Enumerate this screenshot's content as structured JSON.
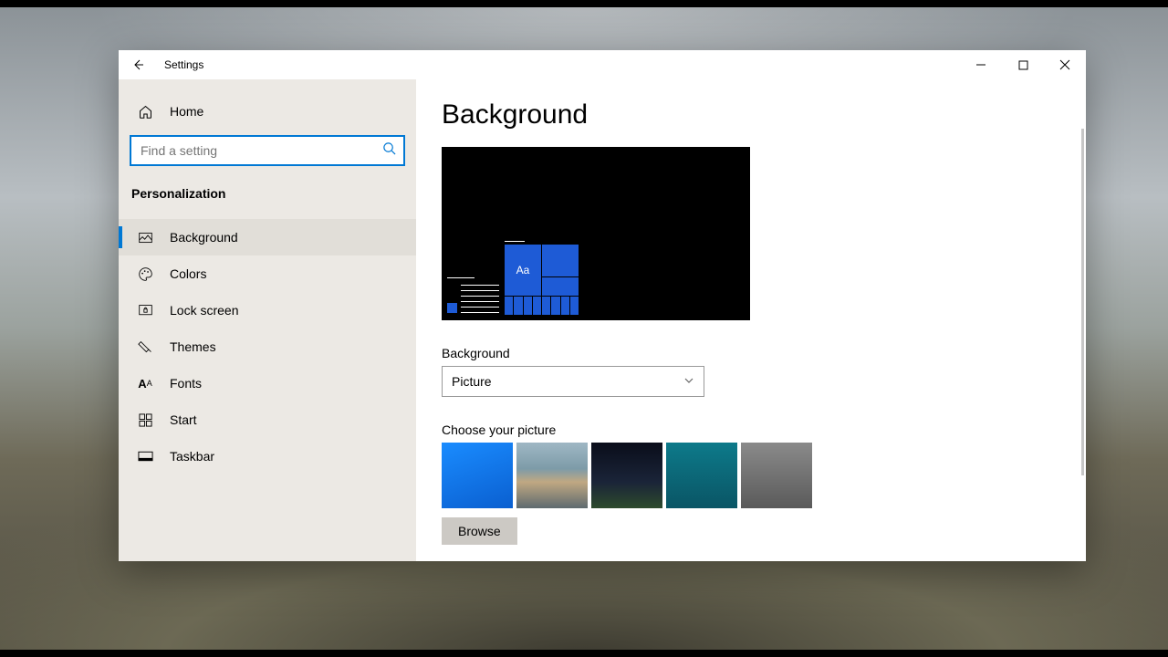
{
  "window": {
    "title": "Settings"
  },
  "sidebar": {
    "home": "Home",
    "search_placeholder": "Find a setting",
    "section": "Personalization",
    "items": [
      {
        "label": "Background",
        "selected": true
      },
      {
        "label": "Colors"
      },
      {
        "label": "Lock screen"
      },
      {
        "label": "Themes"
      },
      {
        "label": "Fonts"
      },
      {
        "label": "Start"
      },
      {
        "label": "Taskbar"
      }
    ]
  },
  "main": {
    "heading": "Background",
    "preview_tile_text": "Aa",
    "bg_label": "Background",
    "bg_dropdown_value": "Picture",
    "choose_label": "Choose your picture",
    "browse_label": "Browse"
  }
}
